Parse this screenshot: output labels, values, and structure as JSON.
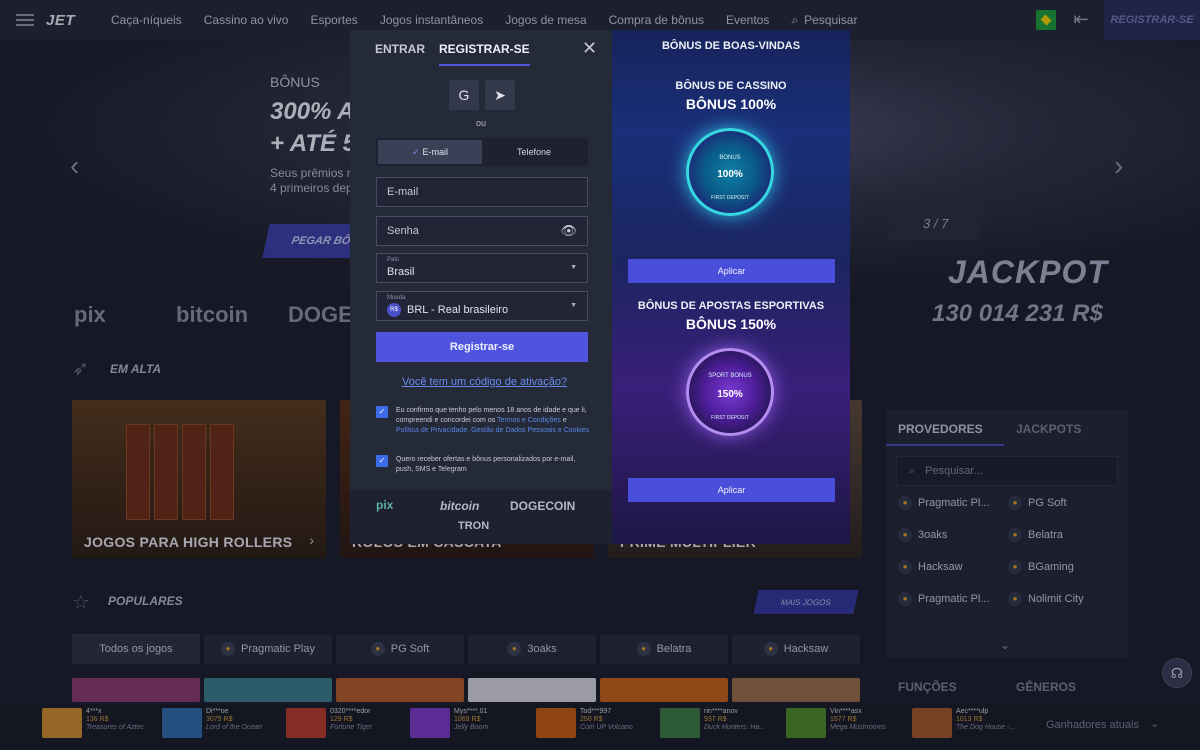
{
  "header": {
    "logo": "JET",
    "nav": [
      "Caça-níqueis",
      "Cassino ao vivo",
      "Esportes",
      "Jogos instantâneos",
      "Jogos de mesa",
      "Compra de bônus",
      "Eventos"
    ],
    "search_label": "Pesquisar",
    "register_label": "REGISTRAR-SE"
  },
  "hero": {
    "label": "BÔNUS",
    "title1": "300% A",
    "title2": "+ ATÉ 5",
    "sub1": "Seus prêmios n",
    "sub2": "4 primeiros dep",
    "button": "PEGAR BÔ",
    "counter": "3 / 7"
  },
  "payments": [
    "pix",
    "bitcoin",
    "DOGECOIN"
  ],
  "jackpot": {
    "label": "JACKPOT",
    "value": "130 014 231 R$"
  },
  "trending": {
    "title": "EM ALTA",
    "cards": [
      "JOGOS PARA HIGH ROLLERS",
      "ROLOS EM CASCATA",
      "PRIME MULTIPLIER"
    ]
  },
  "popular": {
    "title": "POPULARES",
    "more": "MAIS JOGOS",
    "tabs": [
      "Todos os jogos",
      "Pragmatic Play",
      "PG Soft",
      "3oaks",
      "Belatra",
      "Hacksaw"
    ]
  },
  "side": {
    "tabs": [
      "PROVEDORES",
      "JACKPOTS"
    ],
    "search_placeholder": "Pesquisar...",
    "providers": [
      "Pragmatic Pl...",
      "PG Soft",
      "3oaks",
      "Belatra",
      "Hacksaw",
      "BGaming",
      "Pragmatic Pl...",
      "Nolimit City"
    ],
    "bottom_tabs": [
      "FUNÇÕES",
      "GÊNEROS"
    ]
  },
  "winners": {
    "label": "Ganhadores atuais",
    "items": [
      {
        "user": "4***x",
        "amount": "136 R$",
        "game": "Treasures of Aztec",
        "color": "#c98a2b"
      },
      {
        "user": "Di***oe",
        "amount": "3075 R$",
        "game": "Lord of the Ocean",
        "color": "#2f6aa8"
      },
      {
        "user": "0320****edor",
        "amount": "129 R$",
        "game": "Fortune Tiger",
        "color": "#b43a2a"
      },
      {
        "user": "Mys****.01",
        "amount": "1069 R$",
        "game": "Jelly Boom",
        "color": "#7a3ac4"
      },
      {
        "user": "Tod***997",
        "amount": "250 R$",
        "game": "Coin UP Volcano",
        "color": "#c25a16"
      },
      {
        "user": "rin****anov",
        "amount": "937 R$",
        "game": "Duck Hunters: Ha...",
        "color": "#3a7a42"
      },
      {
        "user": "Vin****asx",
        "amount": "1577 R$",
        "game": "Mega Mushrooms",
        "color": "#4d8a2c"
      },
      {
        "user": "Aec****ulp",
        "amount": "1013 R$",
        "game": "The Dog House -...",
        "color": "#a4562a"
      }
    ]
  },
  "modal": {
    "tab_login": "ENTRAR",
    "tab_register": "REGISTRAR-SE",
    "or": "ou",
    "seg_email": "E-mail",
    "seg_phone": "Telefone",
    "email_placeholder": "E-mail",
    "password_placeholder": "Senha",
    "country_label": "País",
    "country_value": "Brasil",
    "currency_label": "Moeda",
    "currency_icon": "R$",
    "currency_value": "BRL - Real brasileiro",
    "submit": "Registrar-se",
    "promo_link": "Você tem um código de ativação?",
    "consent1_a": "Eu confirmo que tenho pelo menos 18 anos de idade e que li, compreendi e concordei com os",
    "consent1_l1": "Termos e Condições",
    "consent1_and": "e",
    "consent1_l2": "Política de Privacidade, Gestão de Dados Pessoais e Cookies",
    "consent2": "Quero receber ofertas e bônus personalizados por e-mail, push, SMS e Telegram",
    "pay_footer": [
      "pix",
      "bitcoin",
      "DOGECOIN",
      "TRON"
    ]
  },
  "bonus": {
    "title": "BÔNUS DE BOAS-VINDAS",
    "casino_caption": "BÔNUS DE CASSINO",
    "casino_value": "BÔNUS 100%",
    "casino_badge_top": "BONUS",
    "casino_badge": "100%",
    "casino_badge_ring": "FIRST DEPOSIT",
    "sport_caption": "BÔNUS DE APOSTAS ESPORTIVAS",
    "sport_value": "BÔNUS 150%",
    "sport_badge_top": "SPORT BONUS",
    "sport_badge": "150%",
    "sport_badge_ring": "FIRST DEPOSIT",
    "apply": "Aplicar"
  },
  "colors": {
    "accent": "#4e54dd",
    "link": "#6a8cf0",
    "bg": "#1b1e2b"
  }
}
